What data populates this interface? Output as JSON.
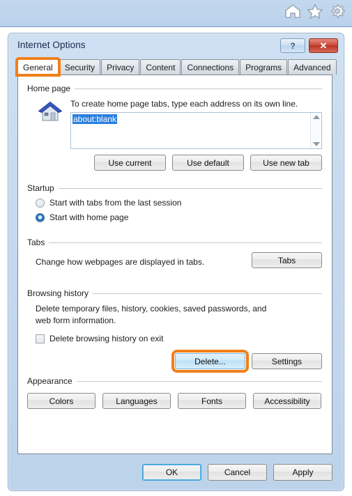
{
  "browser_bar": {
    "icons": [
      {
        "name": "home-icon",
        "label": "Home"
      },
      {
        "name": "favorites-star-icon",
        "label": "Favorites"
      },
      {
        "name": "tools-gear-icon",
        "label": "Tools"
      }
    ]
  },
  "dialog": {
    "title": "Internet Options",
    "help_label": "?",
    "close_label": "✕",
    "tabs": [
      {
        "label": "General",
        "active": true,
        "highlight": true
      },
      {
        "label": "Security",
        "active": false,
        "highlight": false
      },
      {
        "label": "Privacy",
        "active": false,
        "highlight": false
      },
      {
        "label": "Content",
        "active": false,
        "highlight": false
      },
      {
        "label": "Connections",
        "active": false,
        "highlight": false
      },
      {
        "label": "Programs",
        "active": false,
        "highlight": false
      },
      {
        "label": "Advanced",
        "active": false,
        "highlight": false
      }
    ]
  },
  "home_page": {
    "group_label": "Home page",
    "description": "To create home page tabs, type each address on its own line.",
    "value": "about:blank",
    "buttons": [
      {
        "label": "Use current"
      },
      {
        "label": "Use default"
      },
      {
        "label": "Use new tab"
      }
    ]
  },
  "startup": {
    "group_label": "Startup",
    "options": [
      {
        "label": "Start with tabs from the last session",
        "selected": false
      },
      {
        "label": "Start with home page",
        "selected": true
      }
    ]
  },
  "tabs_section": {
    "group_label": "Tabs",
    "description": "Change how webpages are displayed in tabs.",
    "button_label": "Tabs"
  },
  "browsing_history": {
    "group_label": "Browsing history",
    "description_line1": "Delete temporary files, history, cookies, saved passwords, and",
    "description_line2": "web form information.",
    "checkbox_label": "Delete browsing history on exit",
    "checkbox_checked": false,
    "delete_label": "Delete...",
    "settings_label": "Settings"
  },
  "appearance": {
    "group_label": "Appearance",
    "buttons": [
      {
        "label": "Colors"
      },
      {
        "label": "Languages"
      },
      {
        "label": "Fonts"
      },
      {
        "label": "Accessibility"
      }
    ]
  },
  "footer": {
    "ok_label": "OK",
    "cancel_label": "Cancel",
    "apply_label": "Apply"
  },
  "colors": {
    "highlight_orange": "#f07f18",
    "selection_blue": "#2a7fe0",
    "titlebar_blue": "#c6daef",
    "close_red": "#c94a38",
    "focus_blue": "#3c9fd4"
  }
}
